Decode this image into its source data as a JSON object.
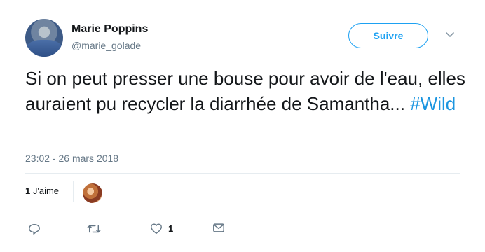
{
  "author": {
    "name": "Marie Poppins",
    "handle": "@marie_golade"
  },
  "follow_button": {
    "label": "Suivre"
  },
  "tweet": {
    "text": "Si on peut presser une bouse pour avoir de l'eau, elles auraient pu recycler la diarrhée de Samantha... ",
    "hashtag": "#Wild",
    "timestamp": "23:02 - 26 mars 2018"
  },
  "likes": {
    "count": "1",
    "label": "J'aime"
  },
  "actions": {
    "reply": {
      "icon": "reply-icon"
    },
    "retweet": {
      "icon": "retweet-icon"
    },
    "like": {
      "icon": "heart-icon",
      "count": "1"
    },
    "dm": {
      "icon": "envelope-icon"
    }
  },
  "colors": {
    "accent": "#1da1f2",
    "hashtag": "#1b95e0",
    "secondary_text": "#657786",
    "action_icon": "#657786"
  }
}
